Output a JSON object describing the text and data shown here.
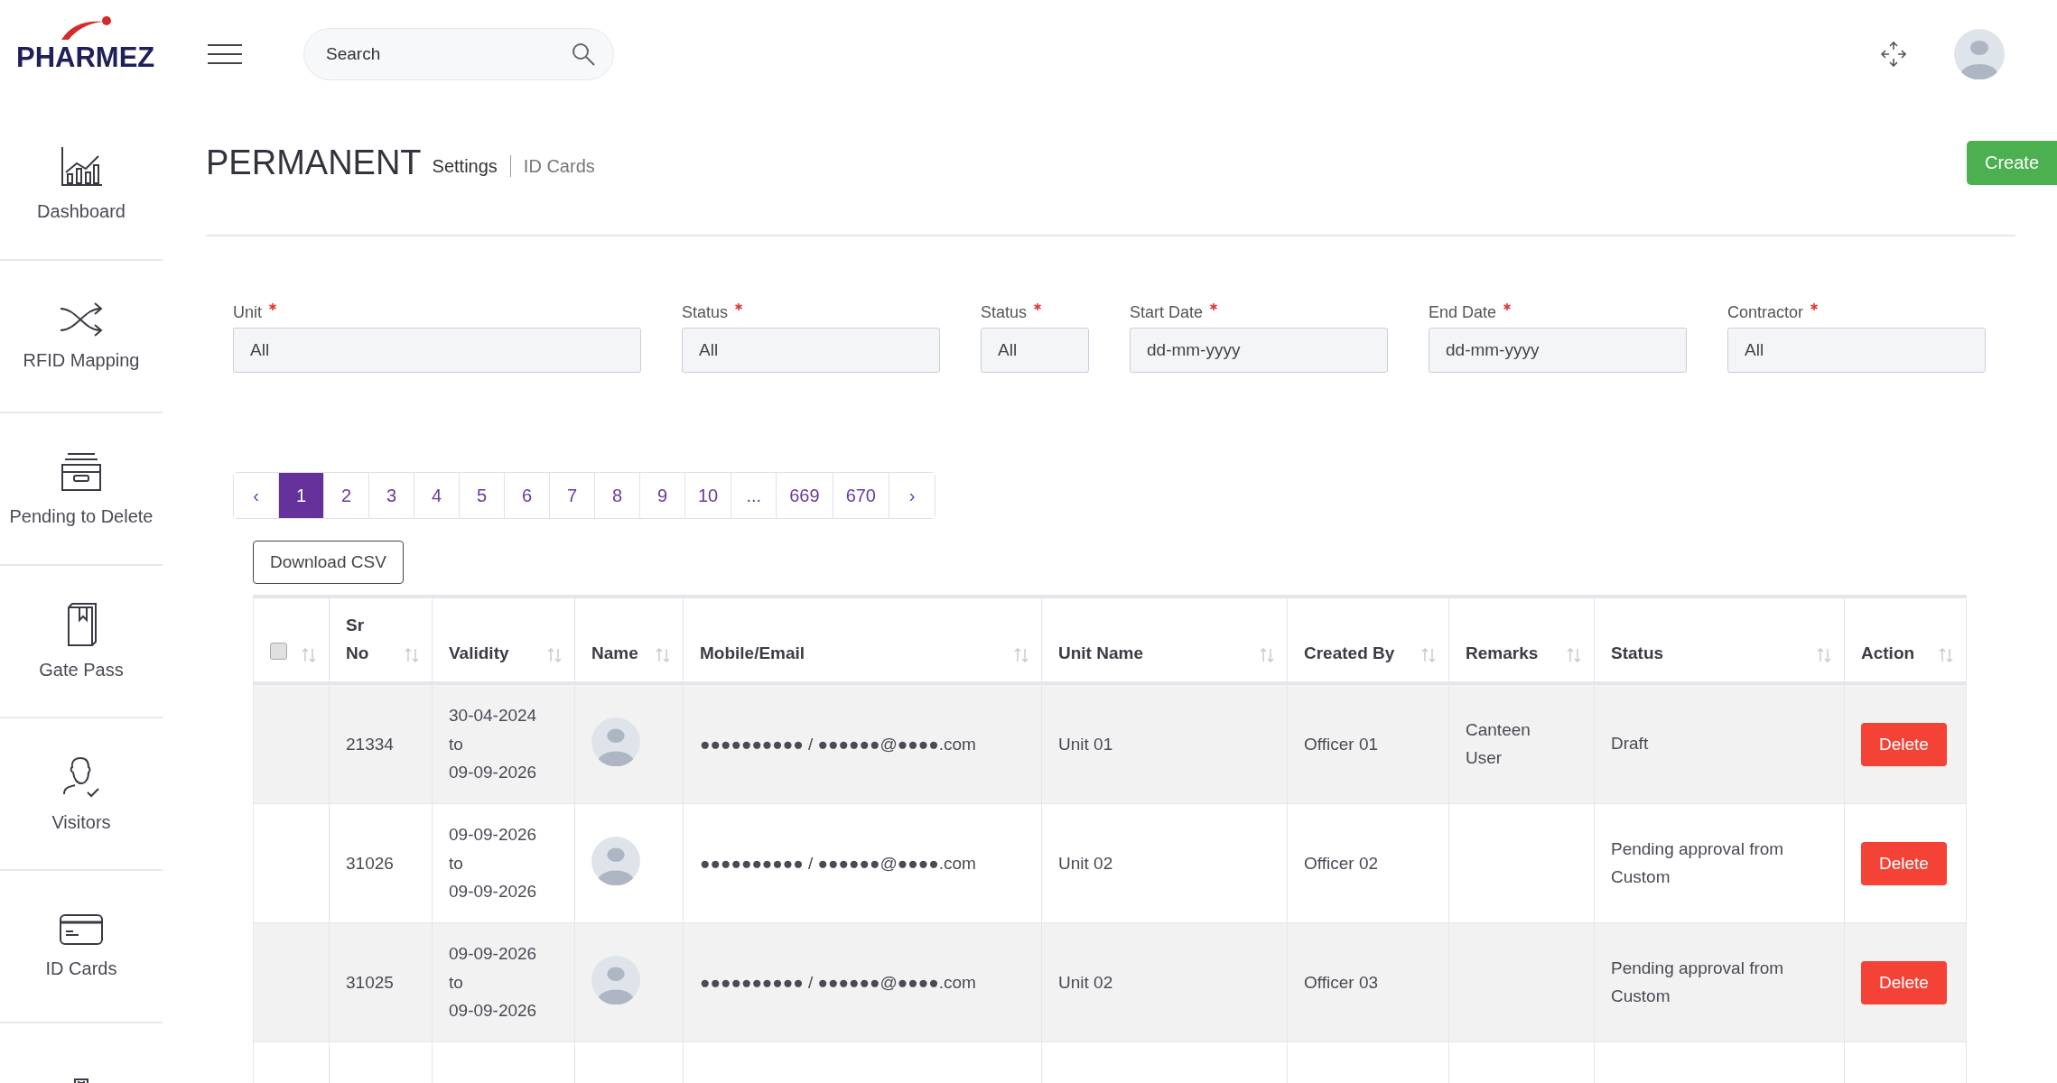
{
  "logo": "PHARMEZ",
  "search": {
    "placeholder": "Search"
  },
  "sidebar": {
    "items": [
      {
        "label": "Dashboard",
        "kind": "chart",
        "selected": false
      },
      {
        "label": "RFID Mapping",
        "kind": "shuffle",
        "selected": false
      },
      {
        "label": "Pending to Delete",
        "kind": "archive",
        "selected": false
      },
      {
        "label": "Gate Pass",
        "kind": "book",
        "selected": false
      },
      {
        "label": "Visitors",
        "kind": "person",
        "selected": false
      },
      {
        "label": "ID Cards",
        "kind": "card",
        "selected": false
      },
      {
        "kind": "building",
        "selected": false
      }
    ]
  },
  "page": {
    "title": "PERMANENT",
    "breadcrumb": [
      "Settings",
      "ID Cards"
    ],
    "create_button": "Create"
  },
  "filters": [
    {
      "label": "Unit",
      "required": true,
      "value": "All",
      "kind": "wide"
    },
    {
      "label": "Status",
      "required": true,
      "value": "All",
      "kind": "mid"
    },
    {
      "label": "Status",
      "required": true,
      "value": "All",
      "kind": "narrow"
    },
    {
      "label": "Start Date",
      "required": true,
      "placeholder": "dd-mm-yyyy",
      "kind": "mid"
    },
    {
      "label": "End Date",
      "required": true,
      "placeholder": "dd-mm-yyyy",
      "kind": "mid"
    },
    {
      "label": "Contractor",
      "required": true,
      "value": "All",
      "kind": "mid"
    }
  ],
  "pagination": [
    {
      "label": "‹",
      "selected": false
    },
    {
      "label": "1",
      "selected": true
    },
    {
      "label": "2",
      "selected": false
    },
    {
      "label": "3",
      "selected": false
    },
    {
      "label": "4",
      "selected": false
    },
    {
      "label": "5",
      "selected": false
    },
    {
      "label": "6",
      "selected": false
    },
    {
      "label": "7",
      "selected": false
    },
    {
      "label": "8",
      "selected": false
    },
    {
      "label": "9",
      "selected": false
    },
    {
      "label": "10",
      "selected": false
    },
    {
      "label": "...",
      "selected": false
    },
    {
      "label": "669",
      "selected": false
    },
    {
      "label": "670",
      "selected": false
    },
    {
      "label": "›",
      "selected": false
    }
  ],
  "download_button": "Download CSV",
  "table": {
    "select_all": {
      "checked": false
    },
    "columns": [
      "Sr No",
      "Validity",
      "Name",
      "Mobile/Email",
      "Unit Name",
      "Created By",
      "Remarks",
      "Status",
      "Action"
    ],
    "rows": [
      {
        "sr_no": "21334",
        "validity": [
          "30-04-2024",
          "to",
          "09-09-2026"
        ],
        "contact": "●●●●●●●●●● / ●●●●●●@●●●●.com",
        "unit": "Unit 01",
        "created_by": "Officer 01",
        "remarks": "Canteen User",
        "status": "Draft",
        "action": "Delete"
      },
      {
        "sr_no": "31026",
        "validity": [
          "09-09-2026",
          "to",
          "09-09-2026"
        ],
        "contact": "●●●●●●●●●● / ●●●●●●@●●●●.com",
        "unit": "Unit 02",
        "created_by": "Officer 02",
        "status": "Pending approval from Custom",
        "action": "Delete"
      },
      {
        "sr_no": "31025",
        "validity": [
          "09-09-2026",
          "to",
          "09-09-2026"
        ],
        "contact": "●●●●●●●●●● / ●●●●●●@●●●●.com",
        "unit": "Unit 02",
        "created_by": "Officer 03",
        "status": "Pending approval from Custom",
        "action": "Delete"
      }
    ]
  }
}
